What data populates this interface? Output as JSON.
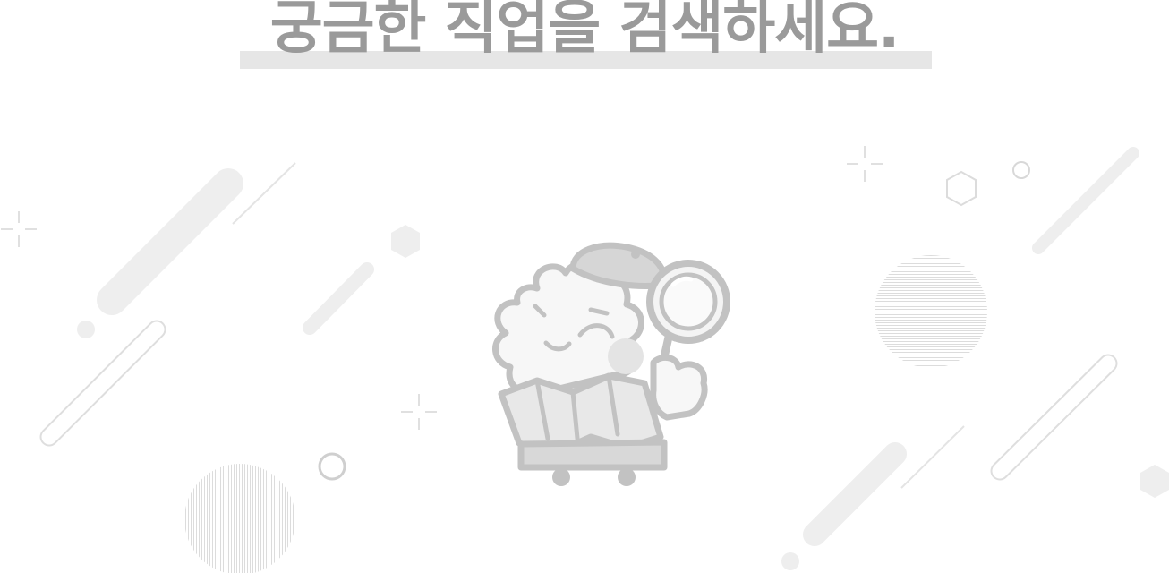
{
  "header": {
    "title": "궁금한 직업을 검색하세요."
  },
  "illustration": {
    "icon": "detective-mascot-magnifier-icon"
  },
  "colors": {
    "title_text": "#9a9a9a",
    "title_highlight": "#e6e6e6",
    "decor_light": "#eeeeee",
    "decor_line": "#e0e0e0",
    "mascot_stroke": "#c2c2c2",
    "mascot_fill": "#f7f7f7"
  }
}
